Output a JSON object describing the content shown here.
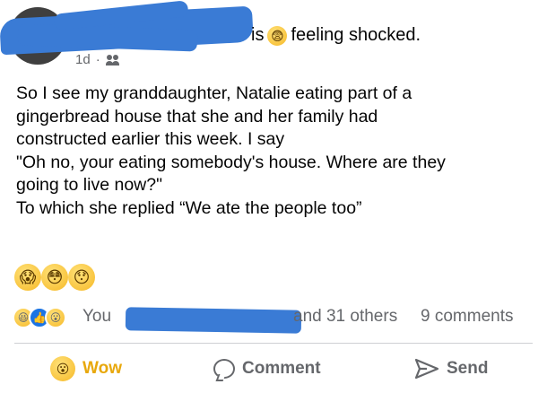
{
  "header": {
    "status_is": "is",
    "feeling_text": "feeling shocked.",
    "feeling_icon": "shocked-emoji-icon",
    "time": "1d",
    "separator": "·",
    "audience_icon": "friends-icon"
  },
  "post": {
    "lines": [
      "So I see my granddaughter, Natalie eating part of a",
      "gingerbread house that she and her family had",
      "constructed earlier this week. I say",
      "\"Oh no, your eating somebody's house. Where are they",
      "going to live now?\"",
      "To which she replied “We ate the people too”"
    ],
    "emojis": [
      "scream",
      "flushed",
      "hushed"
    ]
  },
  "reactions": {
    "icons": [
      "haha",
      "like",
      "wow"
    ],
    "you": "You",
    "others": "and 31 others",
    "comments": "9 comments"
  },
  "actions": {
    "wow": "Wow",
    "comment": "Comment",
    "send": "Send"
  },
  "colors": {
    "accent_wow": "#e8a80c",
    "like_blue": "#1b74e4",
    "redaction": "#3a7bd5",
    "muted_text": "#65676b"
  }
}
